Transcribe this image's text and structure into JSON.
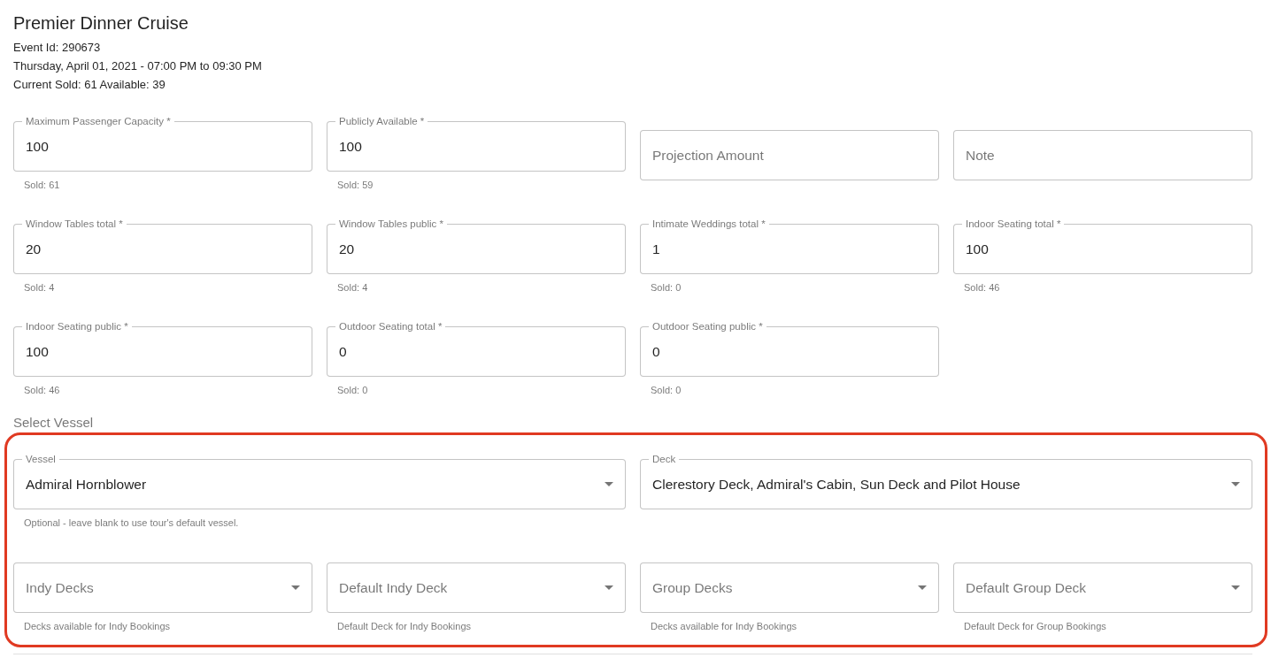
{
  "title": "Premier Dinner Cruise",
  "info": [
    "Event Id: 290673",
    "Thursday, April 01, 2021 - 07:00 PM to 09:30 PM",
    "Current Sold: 61 Available: 39"
  ],
  "capacity_rows": [
    [
      {
        "kind": "text",
        "label": "Maximum Passenger Capacity *",
        "value": "100",
        "helper": "Sold: 61"
      },
      {
        "kind": "text",
        "label": "Publicly Available *",
        "value": "100",
        "helper": "Sold: 59"
      },
      {
        "kind": "text",
        "placeholder": "Projection Amount"
      },
      {
        "kind": "text",
        "placeholder": "Note"
      }
    ],
    [
      {
        "kind": "text",
        "label": "Window Tables total *",
        "value": "20",
        "helper": "Sold: 4"
      },
      {
        "kind": "text",
        "label": "Window Tables public *",
        "value": "20",
        "helper": "Sold: 4"
      },
      {
        "kind": "text",
        "label": "Intimate Weddings total *",
        "value": "1",
        "helper": "Sold: 0"
      },
      {
        "kind": "text",
        "label": "Indoor Seating total *",
        "value": "100",
        "helper": "Sold: 46"
      }
    ],
    [
      {
        "kind": "text",
        "label": "Indoor Seating public *",
        "value": "100",
        "helper": "Sold: 46"
      },
      {
        "kind": "text",
        "label": "Outdoor Seating total *",
        "value": "0",
        "helper": "Sold: 0"
      },
      {
        "kind": "text",
        "label": "Outdoor Seating public *",
        "value": "0",
        "helper": "Sold: 0"
      }
    ]
  ],
  "vessel_section": {
    "title": "Select Vessel",
    "highlighted": true,
    "vessel_fields": [
      {
        "kind": "select",
        "label": "Vessel",
        "value": "Admiral Hornblower",
        "helper": "Optional - leave blank to use tour's default vessel."
      },
      {
        "kind": "select",
        "label": "Deck",
        "value": "Clerestory Deck, Admiral's Cabin, Sun Deck and Pilot House"
      }
    ],
    "deck_fields": [
      {
        "kind": "select",
        "placeholder": "Indy Decks",
        "helper": "Decks available for Indy Bookings"
      },
      {
        "kind": "select",
        "placeholder": "Default Indy Deck",
        "helper": "Default Deck for Indy Bookings"
      },
      {
        "kind": "select",
        "placeholder": "Group Decks",
        "helper": "Decks available for Indy Bookings"
      },
      {
        "kind": "select",
        "placeholder": "Default Group Deck",
        "helper": "Default Deck for Group Bookings"
      }
    ]
  }
}
